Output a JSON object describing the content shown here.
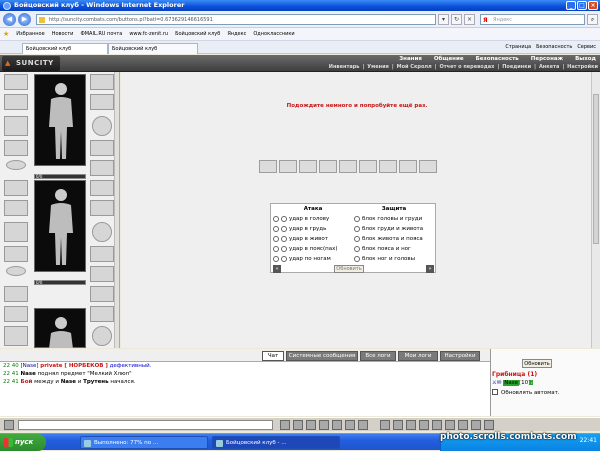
{
  "window": {
    "title": "Бойцовский клуб - Windows Internet Explorer"
  },
  "address": {
    "url": "http://suncity.combats.com/buttons.pl?batl=0.673629146616591"
  },
  "search": {
    "placeholder": "Яндекс"
  },
  "favorites": {
    "label": "Избранное",
    "items": [
      "Новости",
      "ФМAIL.RU почта",
      "www.fc-zenit.ru",
      "Бойцовский клуб",
      "Яндекс",
      "Одноклассники"
    ]
  },
  "tabs": [
    "Бойцовский клуб",
    "Бойцовский клуб"
  ],
  "commandbar": [
    "Страница",
    "Безопасность",
    "Сервис"
  ],
  "game": {
    "logo": "SUNCITY",
    "menu_top": [
      "Знания",
      "Общение",
      "Безопасность",
      "Персонаж",
      "Выход"
    ],
    "menu_sub": [
      "Инвентарь",
      "Умения",
      "Мой Скролл",
      "Отчет о переводах",
      "Поединки",
      "Анкета",
      "Настройки"
    ]
  },
  "hp": {
    "player1": "0/0",
    "player2": "0/0"
  },
  "main": {
    "message": "Подождите немного и попробуйте ещё раз."
  },
  "fight": {
    "attack_title": "Атака",
    "defense_title": "Защита",
    "attack": [
      "удар в голову",
      "удар в грудь",
      "удар в живот",
      "удар в пояс(пах)",
      "удар по ногам"
    ],
    "defense": [
      "блок головы и груди",
      "блок груди и живота",
      "блок живота и пояса",
      "блок пояса и ног",
      "блок ног и головы"
    ],
    "button": "Обновить"
  },
  "chat_tabs": [
    "Чат",
    "Системные сообщения",
    "Все логи",
    "Мои логи",
    "Настройки"
  ],
  "chat": [
    {
      "time": "22 40",
      "name": "[Nase]",
      "priv": "private [ НОРБЕКОВ ]",
      "text": "дефективный."
    },
    {
      "time": "22 41",
      "text1": "Nase",
      "text2": "поднял предмет",
      "text3": "\"Мелкий Хлюп\""
    },
    {
      "time": "22 41",
      "text1": "Бой",
      "text2": "между и",
      "text3": "Nase",
      "text4": "и",
      "text5": "Трутень",
      "text6": "начался."
    }
  ],
  "sidechat": {
    "refresh": "Обновить",
    "room": "Грибница (1)",
    "user": "Nase",
    "level": "[10]",
    "auto": "Обновлять автомат."
  },
  "taskbar": {
    "start": "пуск",
    "tasks": [
      "Выполнено: 77% по ...",
      "Бойцовский клуб - ..."
    ],
    "clock": "22:41"
  },
  "watermark": "photo.scrolls.combats.com"
}
